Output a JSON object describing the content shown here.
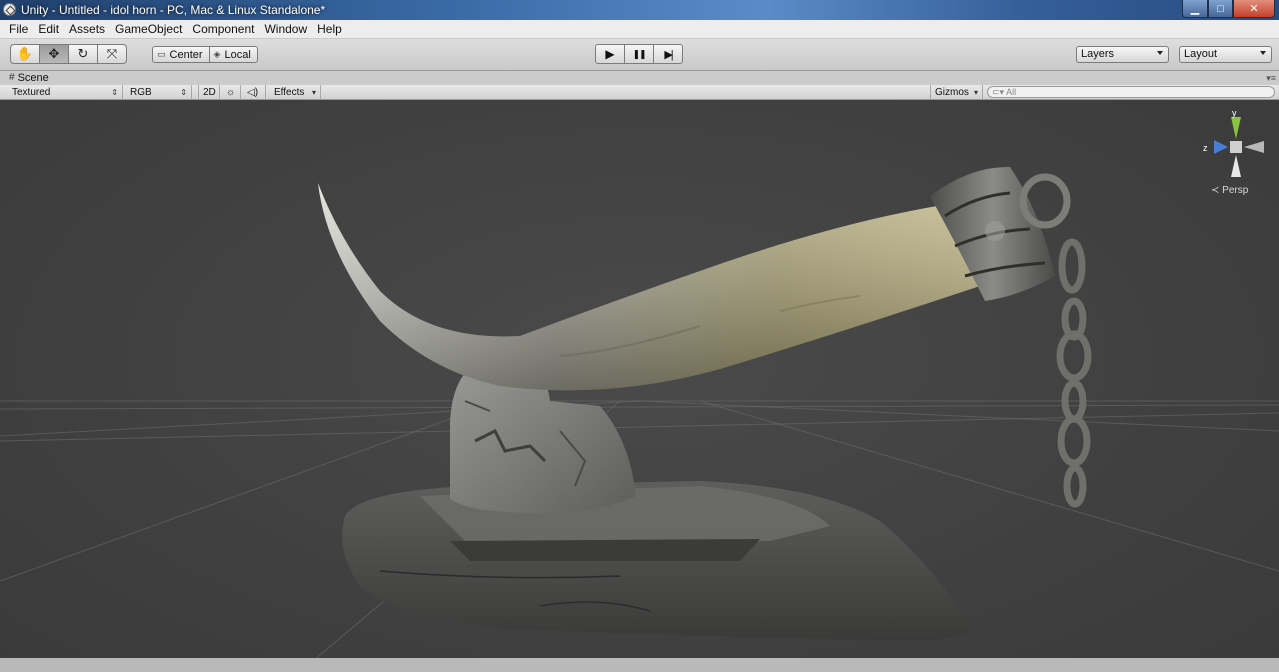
{
  "window": {
    "title": "Unity - Untitled - idol horn - PC, Mac & Linux Standalone*",
    "minimize_label": "▁",
    "maximize_label": "□",
    "close_label": "✕"
  },
  "menu": [
    "File",
    "Edit",
    "Assets",
    "GameObject",
    "Component",
    "Window",
    "Help"
  ],
  "toolbar": {
    "tools": [
      {
        "name": "hand-tool",
        "glyph": "✋"
      },
      {
        "name": "move-tool",
        "glyph": "✥"
      },
      {
        "name": "rotate-tool",
        "glyph": "↻"
      },
      {
        "name": "scale-tool",
        "glyph": "⤧"
      }
    ],
    "pivot_label": "Center",
    "space_label": "Local",
    "play_glyph": "▶",
    "pause_glyph": "❚❚",
    "step_glyph": "▶|",
    "layers_label": "Layers",
    "layout_label": "Layout"
  },
  "scene": {
    "tab_label": "Scene",
    "draw_mode": "Textured",
    "render_mode": "RGB",
    "mode_2d": "2D",
    "effects_label": "Effects",
    "gizmos_label": "Gizmos",
    "search_placeholder": "All",
    "gizmo_y_label": "y",
    "gizmo_z_label": "z",
    "persp_label": "Persp"
  },
  "colors": {
    "viewport_bg": "#404040",
    "horn": "#b9b07e",
    "rock": "#7a7a78",
    "metal": "#6f6f6c"
  }
}
